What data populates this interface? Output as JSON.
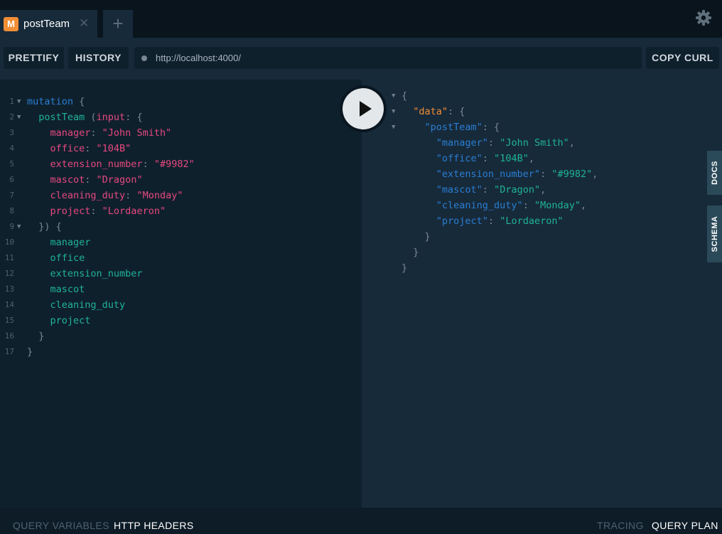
{
  "tab": {
    "badge": "M",
    "label": "postTeam",
    "close": "✕",
    "add": "+"
  },
  "toolbar": {
    "prettify": "PRETTIFY",
    "history": "HISTORY",
    "url": "http://localhost:4000/",
    "copy_curl": "COPY CURL"
  },
  "editor_lines": [
    [
      [
        "kw",
        "mutation "
      ],
      [
        "pu",
        "{"
      ]
    ],
    [
      [
        "f2",
        "  postTeam "
      ],
      [
        "pu",
        "("
      ],
      [
        "pr",
        "input"
      ],
      [
        "pu",
        ": {"
      ]
    ],
    [
      [
        "pr",
        "    manager"
      ],
      [
        "pu",
        ": "
      ],
      [
        "st",
        "\"John Smith\""
      ]
    ],
    [
      [
        "pr",
        "    office"
      ],
      [
        "pu",
        ": "
      ],
      [
        "st",
        "\"104B\""
      ]
    ],
    [
      [
        "pr",
        "    extension_number"
      ],
      [
        "pu",
        ": "
      ],
      [
        "st",
        "\"#9982\""
      ]
    ],
    [
      [
        "pr",
        "    mascot"
      ],
      [
        "pu",
        ": "
      ],
      [
        "st",
        "\"Dragon\""
      ]
    ],
    [
      [
        "pr",
        "    cleaning_duty"
      ],
      [
        "pu",
        ": "
      ],
      [
        "st",
        "\"Monday\""
      ]
    ],
    [
      [
        "pr",
        "    project"
      ],
      [
        "pu",
        ": "
      ],
      [
        "st",
        "\"Lordaeron\""
      ]
    ],
    [
      [
        "pu",
        "  }) {"
      ]
    ],
    [
      [
        "fn",
        "    manager"
      ]
    ],
    [
      [
        "fn",
        "    office"
      ]
    ],
    [
      [
        "fn",
        "    extension_number"
      ]
    ],
    [
      [
        "fn",
        "    mascot"
      ]
    ],
    [
      [
        "fn",
        "    cleaning_duty"
      ]
    ],
    [
      [
        "fn",
        "    project"
      ]
    ],
    [
      [
        "pu",
        "  }"
      ]
    ],
    [
      [
        "pu",
        "}"
      ]
    ]
  ],
  "editor_line_numbers": [
    "1",
    "2",
    "3",
    "4",
    "5",
    "6",
    "7",
    "8",
    "9",
    "10",
    "11",
    "12",
    "13",
    "14",
    "15",
    "16",
    "17"
  ],
  "result_lines": [
    [
      [
        "pu",
        "{"
      ]
    ],
    [
      [
        "dk",
        "  \"data\""
      ],
      [
        "pu",
        ": {"
      ]
    ],
    [
      [
        "rk",
        "    \"postTeam\""
      ],
      [
        "pu",
        ": {"
      ]
    ],
    [
      [
        "rk",
        "      \"manager\""
      ],
      [
        "pu",
        ": "
      ],
      [
        "rs",
        "\"John Smith\""
      ],
      [
        "pu",
        ","
      ]
    ],
    [
      [
        "rk",
        "      \"office\""
      ],
      [
        "pu",
        ": "
      ],
      [
        "rs",
        "\"104B\""
      ],
      [
        "pu",
        ","
      ]
    ],
    [
      [
        "rk",
        "      \"extension_number\""
      ],
      [
        "pu",
        ": "
      ],
      [
        "rs",
        "\"#9982\""
      ],
      [
        "pu",
        ","
      ]
    ],
    [
      [
        "rk",
        "      \"mascot\""
      ],
      [
        "pu",
        ": "
      ],
      [
        "rs",
        "\"Dragon\""
      ],
      [
        "pu",
        ","
      ]
    ],
    [
      [
        "rk",
        "      \"cleaning_duty\""
      ],
      [
        "pu",
        ": "
      ],
      [
        "rs",
        "\"Monday\""
      ],
      [
        "pu",
        ","
      ]
    ],
    [
      [
        "rk",
        "      \"project\""
      ],
      [
        "pu",
        ": "
      ],
      [
        "rs",
        "\"Lordaeron\""
      ]
    ],
    [
      [
        "pu",
        "    }"
      ]
    ],
    [
      [
        "pu",
        "  }"
      ]
    ],
    [
      [
        "pu",
        "}"
      ]
    ]
  ],
  "side_tabs": {
    "docs": "DOCS",
    "schema": "SCHEMA"
  },
  "footer": {
    "query_variables": "QUERY VARIABLES",
    "http_headers": "HTTP HEADERS",
    "tracing": "TRACING",
    "query_plan": "QUERY PLAN"
  },
  "icons": {
    "settings": "gear-icon",
    "run": "play-icon",
    "fold": "chevron-down-icon"
  },
  "colors": {
    "keyword": "#2a7ed2",
    "field": "#1fb399",
    "argument": "#e6487f",
    "data_key": "#f28e35",
    "badge": "#f28e35"
  }
}
